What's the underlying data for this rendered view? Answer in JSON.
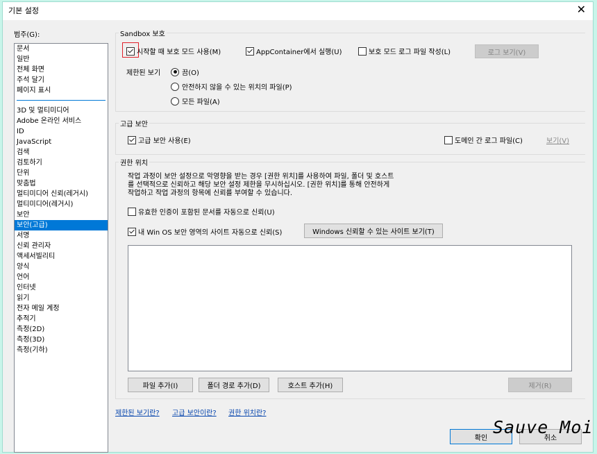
{
  "window": {
    "title": "기본 설정",
    "close_glyph": "✕"
  },
  "categories": {
    "label": "범주(G):",
    "group1": [
      "문서",
      "일반",
      "전체 화면",
      "주석 달기",
      "페이지 표시"
    ],
    "group2": [
      "3D 및 멀티미디어",
      "Adobe 온라인 서비스",
      "ID",
      "JavaScript",
      "검색",
      "검토하기",
      "단위",
      "맞춤법",
      "멀티미디어 신뢰(레거시)",
      "멀티미디어(레거시)",
      "보안",
      "보안(고급)",
      "서명",
      "신뢰 관리자",
      "액세서빌리티",
      "양식",
      "언어",
      "인터넷",
      "읽기",
      "전자 메일 계정",
      "추적기",
      "측정(2D)",
      "측정(3D)",
      "측정(기하)"
    ],
    "selected": "보안(고급)"
  },
  "sandbox": {
    "title": "Sandbox 보호",
    "protected_mode": {
      "label": "시작할 때 보호 모드 사용(M)",
      "checked": true
    },
    "app_container": {
      "label": "AppContainer에서 실행(U)",
      "checked": true
    },
    "log_file": {
      "label": "보호 모드 로그 파일 작성(L)",
      "checked": false
    },
    "view_log_button": "로그 보기(V)",
    "restricted_view_label": "제한된 보기",
    "radio_off": "끔(O)",
    "radio_unsafe": "안전하지 않을 수 있는 위치의 파일(P)",
    "radio_all": "모든 파일(A)",
    "selected_radio": "off"
  },
  "enhanced": {
    "title": "고급 보안",
    "enable": {
      "label": "고급 보안 사용(E)",
      "checked": true
    },
    "cross_domain": {
      "label": "도메인 간 로그 파일(C)",
      "checked": false
    },
    "view_link": "보기(V)"
  },
  "privileged": {
    "title": "권한 위치",
    "description": [
      "작업 과정이 보안 설정으로 악영향을 받는 경우 [권한 위치]를 사용하여 파일, 폴더 및 호스트",
      "를 선택적으로 신뢰하고 해당 보안 설정 제한을 무시하십시오. [권한 위치]를 통해 안전하게",
      "작업하고 작업 과정의 항목에 신뢰를 부여할 수 있습니다."
    ],
    "cert_docs": {
      "label": "유효한 인증이 포함된 문서를 자동으로 신뢰(U)",
      "checked": false
    },
    "win_os_zone": {
      "label": "내 Win OS 보안 영역의 사이트 자동으로 신뢰(S)",
      "checked": true
    },
    "view_trusted_sites_button": "Windows 신뢰할 수 있는 사이트 보기(T)",
    "add_file_button": "파일 추가(I)",
    "add_folder_button": "폴더 경로 추가(D)",
    "add_host_button": "호스트 추가(H)",
    "remove_button": "제거(R)"
  },
  "links": {
    "what_restricted": "제한된 보기란?",
    "what_enhanced": "고급 보안이란?",
    "what_privileged": "권한 위치란?"
  },
  "footer": {
    "ok_button": "확인",
    "cancel_button": "취소"
  },
  "watermark": "Sauve Moi"
}
